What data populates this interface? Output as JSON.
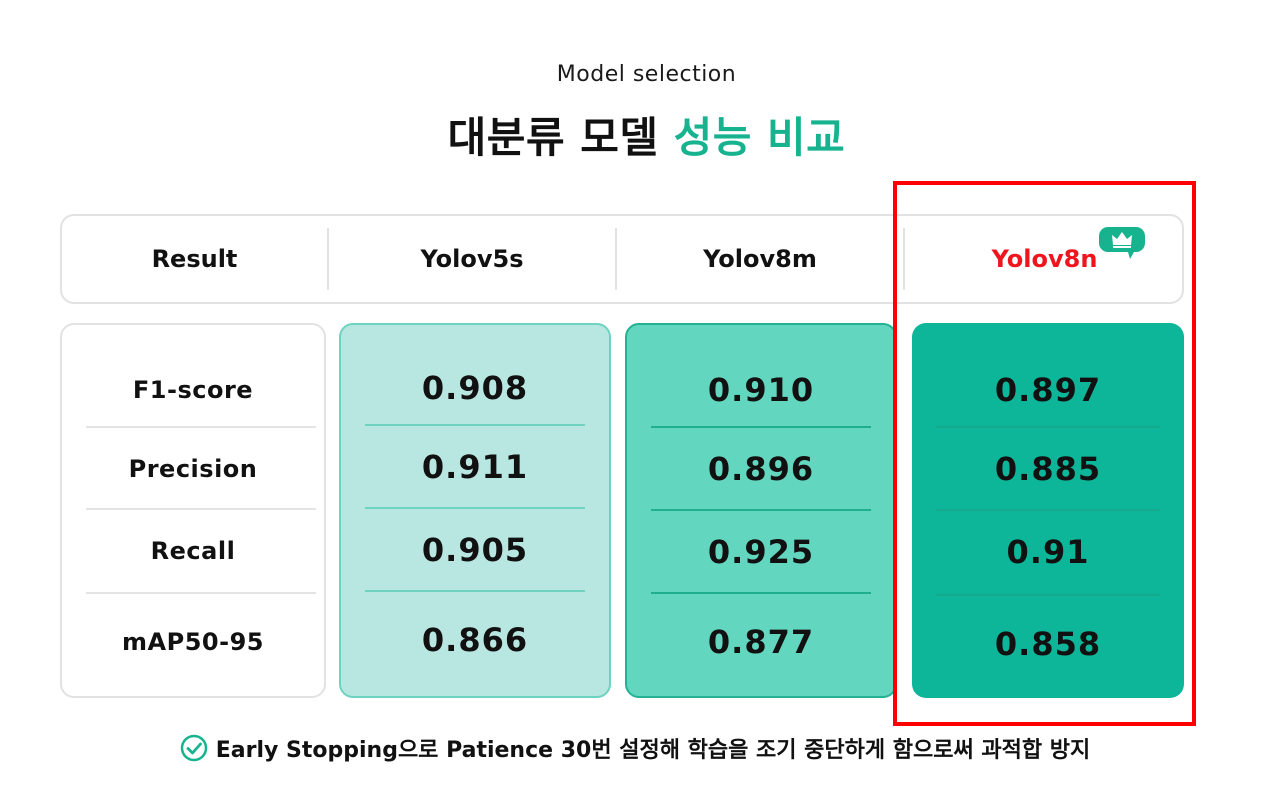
{
  "header": {
    "subtitle": "Model selection",
    "title_main": "대분류 모델",
    "title_accent": "성능 비교"
  },
  "columns": {
    "result": "Result",
    "model1": "Yolov5s",
    "model2": "Yolov8m",
    "model3": "Yolov8n"
  },
  "metrics": [
    "F1-score",
    "Precision",
    "Recall",
    "mAP50-95"
  ],
  "values": {
    "model1": [
      "0.908",
      "0.911",
      "0.905",
      "0.866"
    ],
    "model2": [
      "0.910",
      "0.896",
      "0.925",
      "0.877"
    ],
    "model3": [
      "0.897",
      "0.885",
      "0.91",
      "0.858"
    ]
  },
  "footer": {
    "note": "Early Stopping으로 Patience 30번 설정해 학습을 조기 중단하게 함으로써 과적합 방지",
    "icon": "check-circle-icon"
  },
  "best_badge_icon": "crown-icon",
  "colors": {
    "accent": "#17b38f",
    "highlight": "#ff0000",
    "best_label": "#f0141c",
    "col1_bg": "#b8e6e0",
    "col2_bg": "#63d6bf",
    "col3_bg": "#0db699"
  }
}
